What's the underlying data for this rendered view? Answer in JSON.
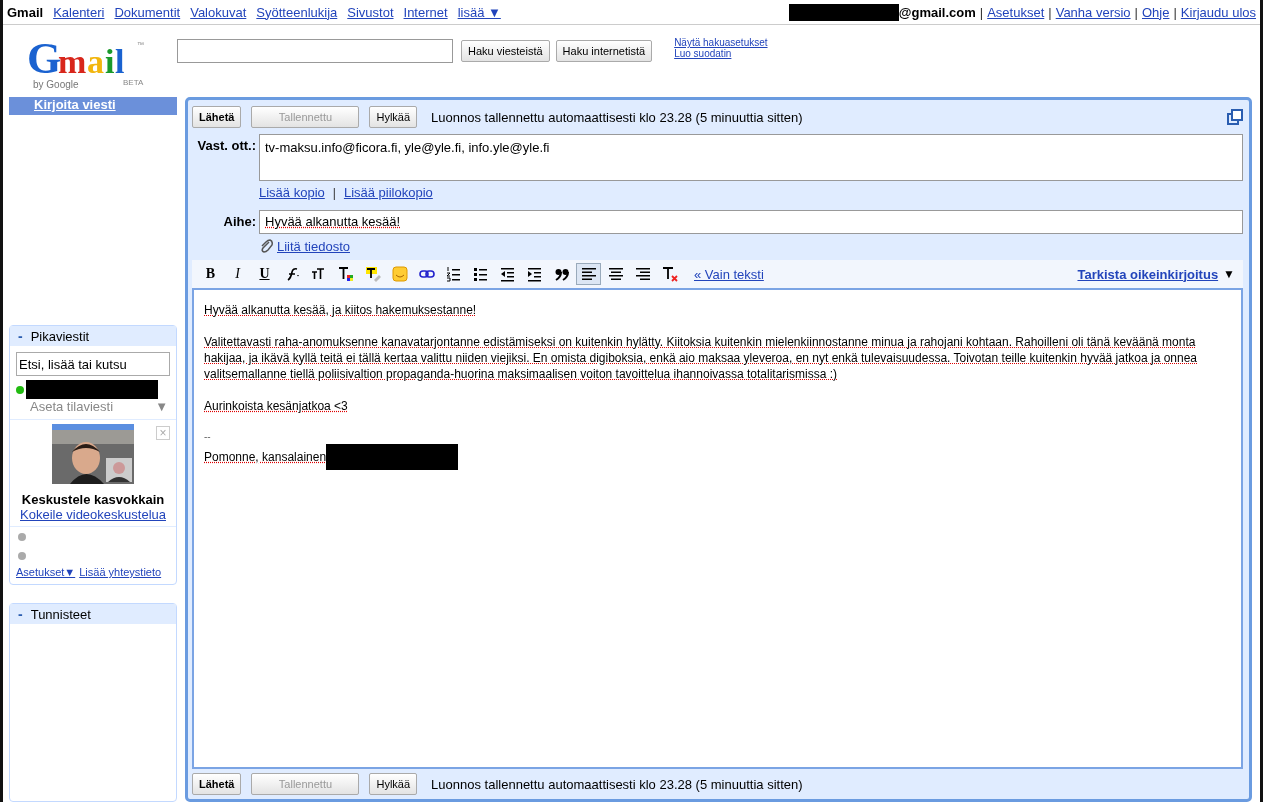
{
  "top_bar": {
    "brand": "Gmail",
    "links": [
      "Kalenteri",
      "Dokumentit",
      "Valokuvat",
      "Syötteenlukija",
      "Sivustot",
      "Internet"
    ],
    "more": "lisää ▼",
    "account_redacted": true,
    "account_suffix": "@gmail.com",
    "account_links": [
      {
        "separator": "|",
        "label": "Asetukset"
      },
      {
        "separator": "|",
        "label": "Vanha versio"
      },
      {
        "separator": "|",
        "label": "Ohje"
      },
      {
        "separator": "|",
        "label": "Kirjaudu ulos"
      }
    ]
  },
  "header": {
    "logo": {
      "letters": "Gmail",
      "trademark": "™",
      "byline": "by Google",
      "badge": "BETA"
    },
    "buttons": [
      "Haku viesteistä",
      "Haku internetistä"
    ],
    "links": [
      "Näytä hakuasetukset",
      "Luo suodatin"
    ]
  },
  "sidebar": {
    "compose": "Kirjoita viesti",
    "chat": {
      "title": "Pikaviestit",
      "collapse": "-",
      "search": {
        "placeholder": "Etsi, lisää tai kutsu"
      },
      "online": true,
      "status_placeholder": "Aseta tilaviesti",
      "status_caret": "▼",
      "promo": {
        "close": "×",
        "title": "Keskustele kasvokkain",
        "link": "Kokeile videokeskustelua"
      },
      "contacts": [
        {
          "online": false
        },
        {
          "online": false
        }
      ],
      "footer_links": [
        "Asetukset▼",
        "Lisää yhteystieto"
      ]
    },
    "labels": {
      "title": "Tunnisteet",
      "collapse": "-"
    }
  },
  "compose": {
    "top_actions": {
      "buttons": [
        {
          "label": "Lähetä",
          "kind": "primary",
          "disabled": false
        },
        {
          "label": "Tallennettu",
          "kind": "wide",
          "disabled": true
        },
        {
          "label": "Hylkää",
          "kind": "normal",
          "disabled": false
        }
      ],
      "draft_status": "Luonnos tallennettu automaattisesti klo 23.28 (5 minuuttia sitten)"
    },
    "to": {
      "label": "Vast. ott.:",
      "value": "tv-maksu.info@ficora.fi, yle@yle.fi, info.yle@yle.fi"
    },
    "cc_links": {
      "cc": "Lisää kopio",
      "separator": "|",
      "bcc": "Lisää piilokopio"
    },
    "subject": {
      "label": "Aihe:",
      "value": "Hyvää alkanutta kesää!"
    },
    "attach": "Liitä tiedosto",
    "toolbar": [
      {
        "kind": "bold",
        "label": "B",
        "selected": false
      },
      {
        "kind": "italic",
        "label": "I",
        "selected": false
      },
      {
        "kind": "underline",
        "label": "U",
        "selected": false
      },
      {
        "kind": "font",
        "selected": false
      },
      {
        "kind": "size",
        "selected": false
      },
      {
        "kind": "text-color",
        "selected": false
      },
      {
        "kind": "highlight",
        "selected": false
      },
      {
        "kind": "emoticon",
        "selected": false
      },
      {
        "kind": "link",
        "selected": false
      },
      {
        "kind": "numbered-list",
        "selected": false
      },
      {
        "kind": "bullet-list",
        "selected": false
      },
      {
        "kind": "outdent",
        "selected": false
      },
      {
        "kind": "indent",
        "selected": false
      },
      {
        "kind": "quote",
        "selected": false
      },
      {
        "kind": "align-left",
        "selected": true
      },
      {
        "kind": "align-center",
        "selected": false
      },
      {
        "kind": "align-right",
        "selected": false
      },
      {
        "kind": "clear-format",
        "selected": false
      }
    ],
    "plain_text_link": "« Vain teksti",
    "spellcheck": "Tarkista oikeinkirjoitus",
    "spellcheck_caret": "▼",
    "body": [
      "Hyvää alkanutta kesää, ja kiitos hakemuksestanne!",
      "Valitettavasti raha-anomuksenne kanavatarjontanne edistämiseksi on kuitenkin hylätty. Kiitoksia kuitenkin mielenkiinnostanne minua ja rahojani kohtaan. Rahoilleni oli tänä keväänä monta hakijaa, ja ikävä kyllä teitä ei tällä kertaa valittu niiden viejiksi. En omista digiboksia, enkä aio maksaa yleveroa, en nyt enkä tulevaisuudessa. Toivotan teille kuitenkin hyvää jatkoa ja onnea valitsemallanne tiellä poliisivaltion propaganda-huorina maksimaalisen voiton tavoittelua ihannoivassa totalitarismissa :)",
      "Aurinkoista kesänjatkoa <3"
    ],
    "signature": {
      "separator": "--",
      "line": "Pomonne, kansalainen",
      "redacted": true
    },
    "bottom_actions": {
      "buttons": [
        {
          "label": "Lähetä",
          "kind": "primary",
          "disabled": false
        },
        {
          "label": "Tallennettu",
          "kind": "wide",
          "disabled": true
        },
        {
          "label": "Hylkää",
          "kind": "normal",
          "disabled": false
        }
      ],
      "draft_status": "Luonnos tallennettu automaattisesti klo 23.28 (5 minuuttia sitten)"
    }
  }
}
